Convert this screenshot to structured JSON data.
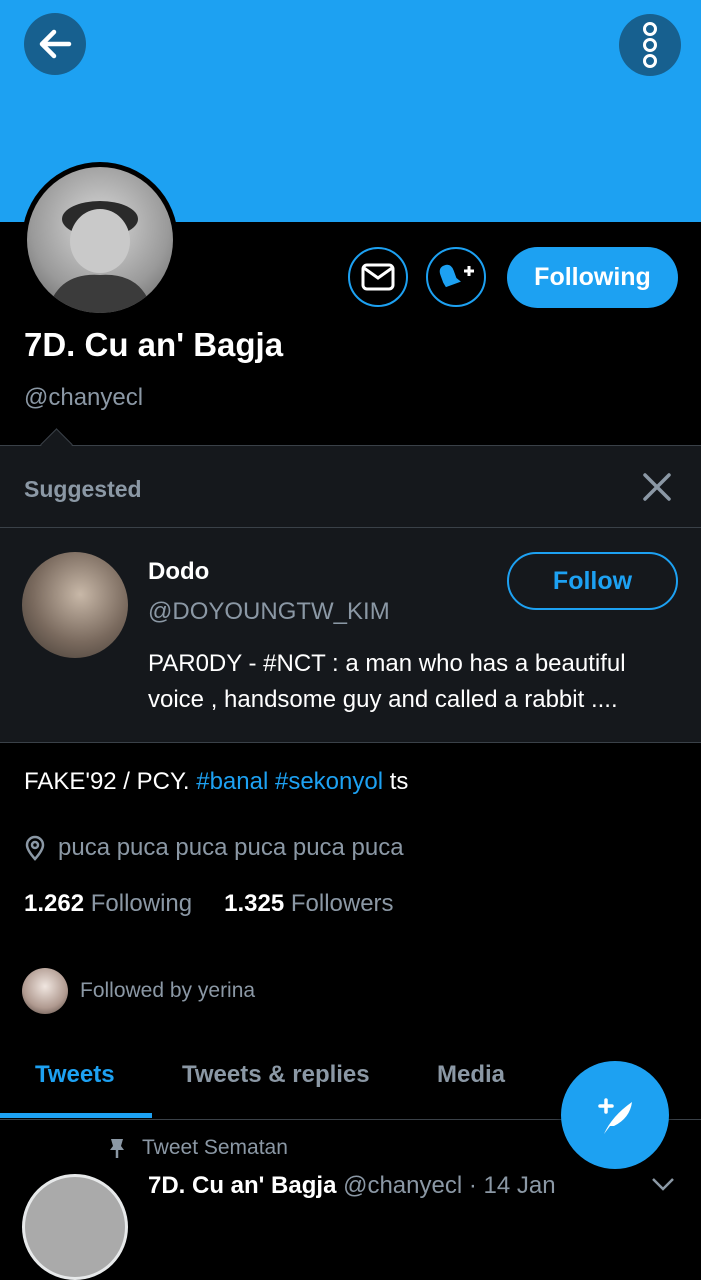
{
  "header": {
    "back_icon": "arrow-left-icon",
    "more_icon": "vertical-dots-icon",
    "banner_color": "#1da1f2"
  },
  "profile": {
    "name": "7D. Cu an' Bagja",
    "handle": "@chanyecl",
    "following_button": "Following",
    "message_icon": "envelope-icon",
    "notify_icon": "bell-plus-icon"
  },
  "suggested": {
    "title": "Suggested",
    "user": {
      "name": "Dodo",
      "handle": "@DOYOUNGTW_KIM",
      "bio": "PAR0DY - #NCT : a man who has a beautiful voice , handsome guy and called a rabbit ....",
      "follow_button": "Follow"
    }
  },
  "bio": {
    "prefix": "FAKE'92 / PCY. ",
    "tag1": "#banal",
    "tag2": "#sekonyol",
    "suffix": " ts"
  },
  "location": "puca puca puca puca puca puca",
  "stats": {
    "following_count": "1.262",
    "following_label": "Following",
    "followers_count": "1.325",
    "followers_label": "Followers"
  },
  "followed_by": "Followed by yerina",
  "tabs": [
    "Tweets",
    "Tweets & replies",
    "Media"
  ],
  "pinned": {
    "label": "Tweet Sematan",
    "name": "7D. Cu an' Bagja",
    "handle": "@chanyecl",
    "date": "· 14 Jan"
  },
  "colors": {
    "accent": "#1da1f2",
    "background": "#000000",
    "muted": "#8b98a5"
  }
}
